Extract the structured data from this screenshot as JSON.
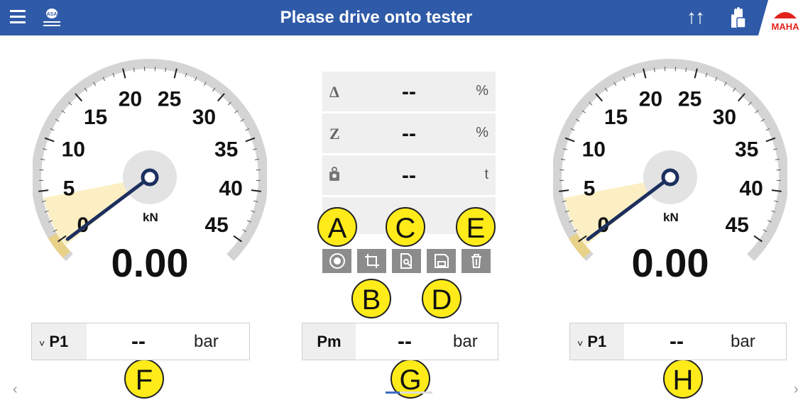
{
  "header": {
    "title": "Please drive onto tester",
    "menu_icon": "menu-icon",
    "brand_logo_text": "MAHA",
    "accent_color": "#2f5aa8"
  },
  "gauges": {
    "left": {
      "value": "0.00",
      "unit": "kN",
      "ticks": [
        "0",
        "5",
        "10",
        "15",
        "20",
        "25",
        "30",
        "35",
        "40",
        "45"
      ]
    },
    "right": {
      "value": "0.00",
      "unit": "kN",
      "ticks": [
        "0",
        "5",
        "10",
        "15",
        "20",
        "25",
        "30",
        "35",
        "40",
        "45"
      ]
    }
  },
  "center": {
    "rows": [
      {
        "symbol": "Δ",
        "value": "--",
        "unit": "%"
      },
      {
        "symbol": "Z",
        "value": "--",
        "unit": "%"
      },
      {
        "symbol": "weight-icon",
        "value": "--",
        "unit": "t"
      }
    ],
    "toolbar": [
      "brake-icon",
      "crop-icon",
      "search-document-icon",
      "save-icon",
      "delete-icon"
    ]
  },
  "pressure": {
    "left": {
      "label": "P1",
      "value": "--",
      "unit": "bar"
    },
    "middle": {
      "label": "Pm",
      "value": "--",
      "unit": "bar"
    },
    "right": {
      "label": "P1",
      "value": "--",
      "unit": "bar"
    }
  },
  "annotations": [
    "A",
    "B",
    "C",
    "D",
    "E",
    "F",
    "G",
    "H"
  ],
  "nav": {
    "prev": "‹",
    "next": "›"
  }
}
